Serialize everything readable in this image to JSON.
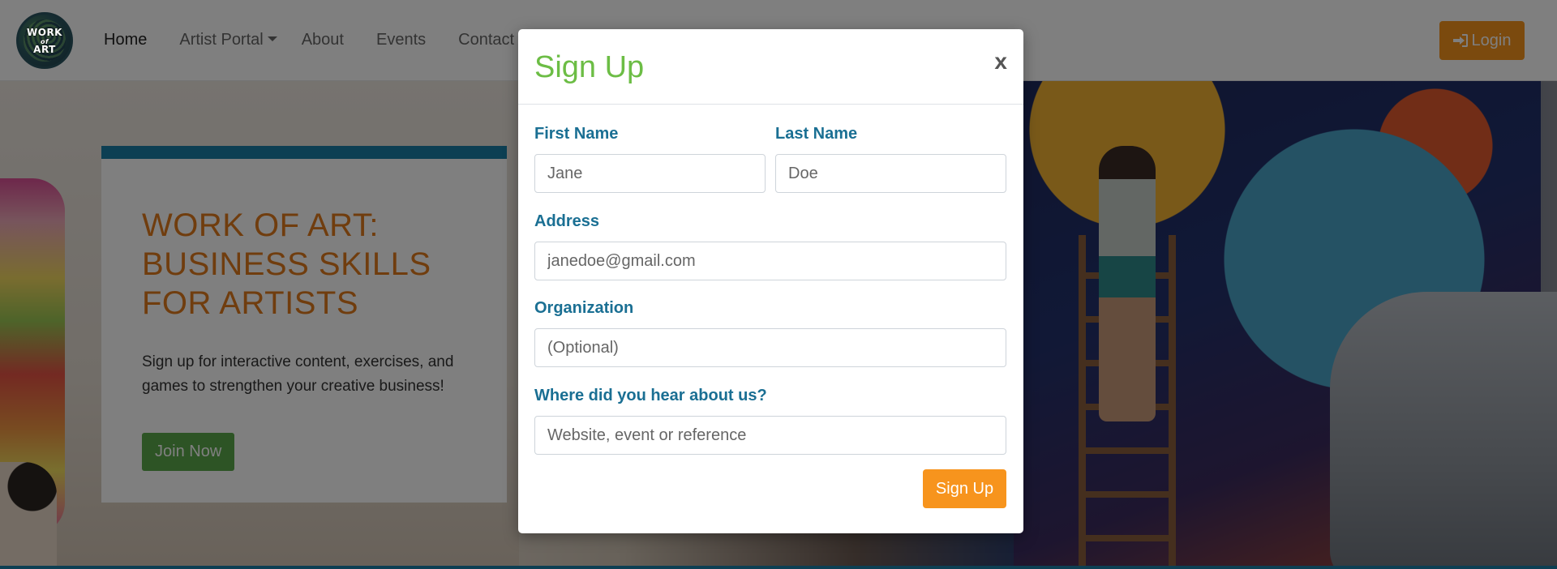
{
  "logo": {
    "line1": "WORK",
    "line2": "of",
    "line3": "ART"
  },
  "nav": {
    "items": [
      {
        "label": "Home"
      },
      {
        "label": "Artist Portal"
      },
      {
        "label": "About"
      },
      {
        "label": "Events"
      },
      {
        "label": "Contact"
      }
    ],
    "login_label": "Login"
  },
  "hero": {
    "title": "WORK OF ART: BUSINESS SKILLS FOR ARTISTS",
    "subtitle": "Sign up for interactive content, exercises, and games to strengthen your creative business!",
    "cta_label": "Join Now"
  },
  "modal": {
    "title": "Sign Up",
    "close_label": "x",
    "fields": {
      "first_name": {
        "label": "First Name",
        "placeholder": "Jane"
      },
      "last_name": {
        "label": "Last Name",
        "placeholder": "Doe"
      },
      "address": {
        "label": "Address",
        "placeholder": "janedoe@gmail.com"
      },
      "organization": {
        "label": "Organization",
        "placeholder": "(Optional)"
      },
      "referral": {
        "label": "Where did you hear about us?",
        "placeholder": "Website, event or reference"
      }
    },
    "submit_label": "Sign Up"
  },
  "colors": {
    "accent_orange": "#f7941d",
    "title_green": "#6cbd45",
    "label_blue": "#1a6f93",
    "hero_title_orange": "#e07b1d",
    "join_green": "#5aa84a",
    "card_border_blue": "#1a7fa6"
  },
  "icons": {
    "login": "sign-in-icon",
    "close": "close-icon"
  }
}
